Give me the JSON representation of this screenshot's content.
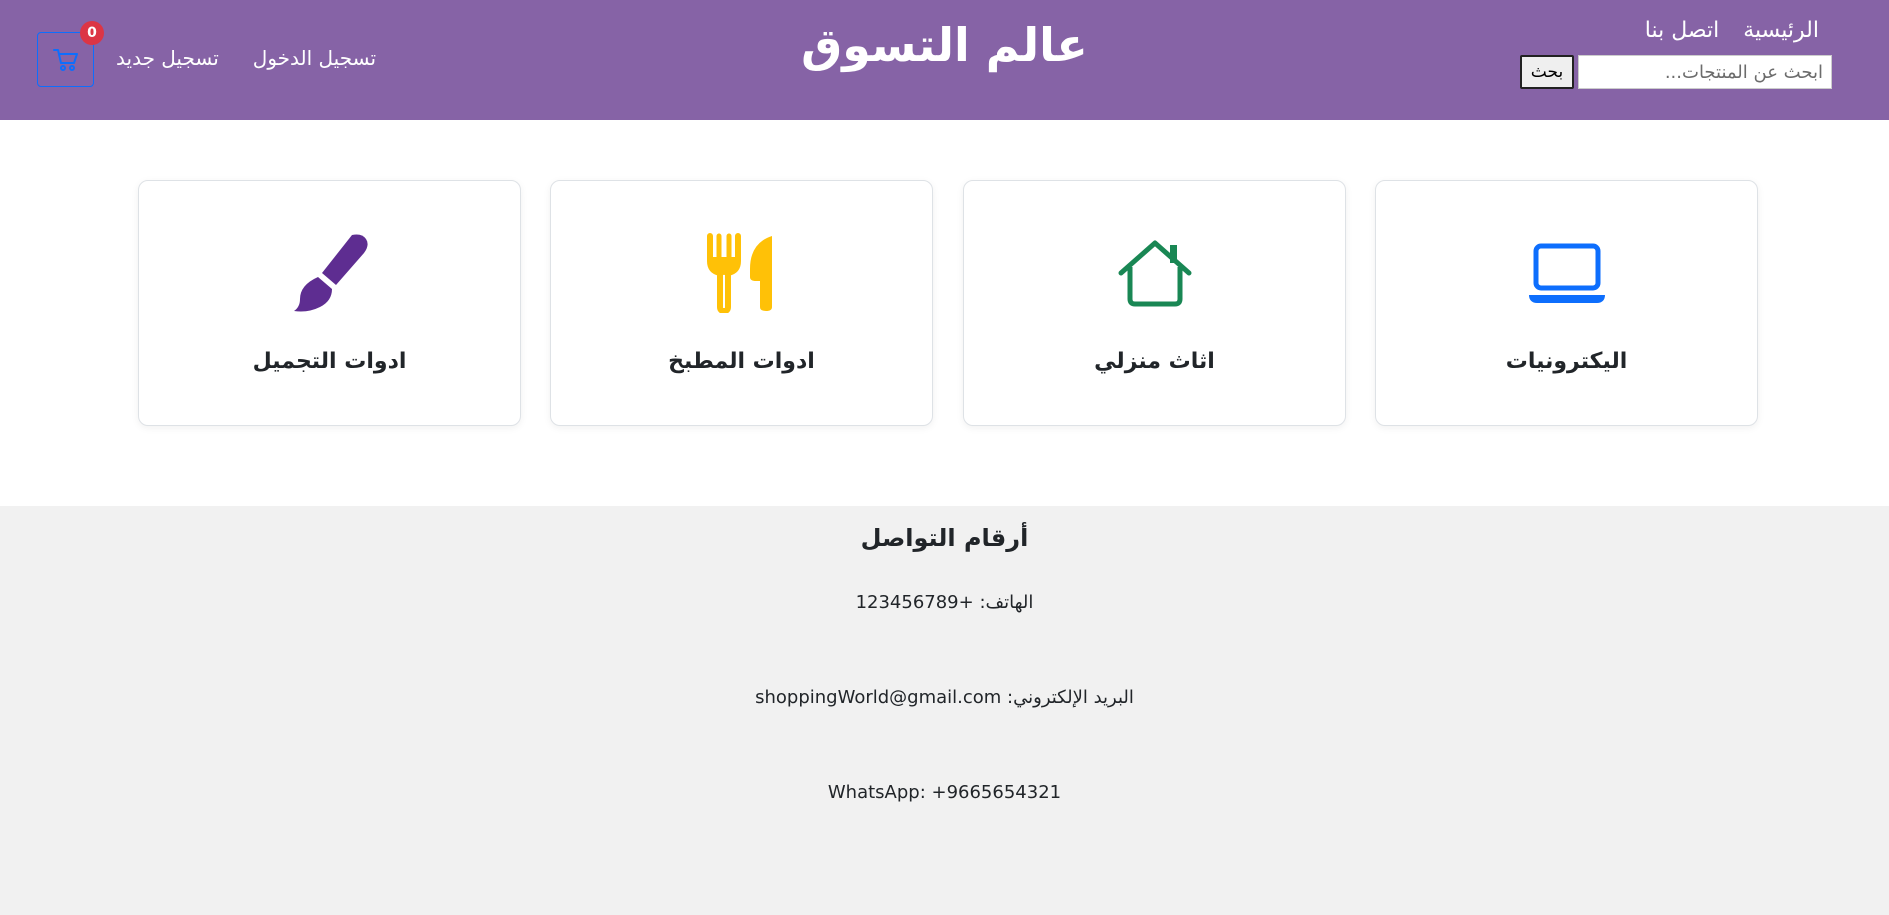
{
  "header": {
    "site_title": "عالم التسوق",
    "nav": {
      "home_label": "الرئيسية",
      "contact_label": "اتصل بنا"
    },
    "search": {
      "placeholder": "ابحث عن المنتجات...",
      "value": "",
      "button_label": "بحث"
    },
    "auth": {
      "login_label": "تسجيل الدخول",
      "register_label": "تسجيل جديد"
    },
    "cart": {
      "count": "0",
      "icon": "cart-icon"
    },
    "colors": {
      "header_bg": "#8663a6",
      "cart_border": "#0d6efd",
      "badge_bg": "#dc3545"
    }
  },
  "categories": [
    {
      "label": "اليكترونيات",
      "icon": "laptop-icon",
      "color": "#0d6efd"
    },
    {
      "label": "اثاث منزلي",
      "icon": "house-icon",
      "color": "#198754"
    },
    {
      "label": "ادوات المطبخ",
      "icon": "utensils-icon",
      "color": "#ffc107"
    },
    {
      "label": "ادوات التجميل",
      "icon": "brush-icon",
      "color": "#5e2d91"
    }
  ],
  "footer": {
    "title": "أرقام التواصل",
    "phone": "الهاتف: +123456789",
    "email": "البريد الإلكتروني: shoppingWorld@gmail.com",
    "whatsapp": "WhatsApp: +9665654321",
    "bg_color": "#f1f1f1"
  }
}
